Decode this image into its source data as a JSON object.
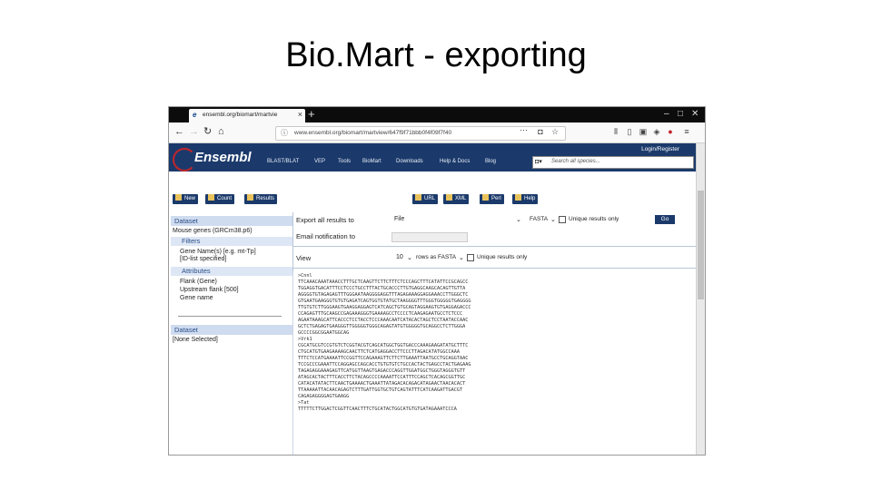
{
  "slide": {
    "title": "Bio.Mart - exporting"
  },
  "browser": {
    "tab_title": "ensembl.org/biomart/martvie",
    "url": "www.ensembl.org/biomart/martview/647f9f71bbb0f4f09f7f40",
    "window_controls": [
      "–",
      "□",
      "✕"
    ]
  },
  "ensembl": {
    "logo": "Ensembl",
    "nav": [
      "BLAST/BLAT",
      "VEP",
      "Tools",
      "BioMart",
      "Downloads",
      "Help & Docs",
      "Blog"
    ],
    "login": "Login/Register",
    "search_placeholder": "Search all species..."
  },
  "toolbar": {
    "new": "New",
    "count": "Count",
    "results": "Results",
    "url": "URL",
    "xml": "XML",
    "perl": "Perl",
    "help": "Help"
  },
  "left_panel": {
    "dataset_header": "Dataset",
    "dataset_value": "Mouse genes (GRCm38.p6)",
    "filters_header": "Filters",
    "filter_lines": [
      "Gene Name(s) [e.g. mt-Tp]",
      "[ID-list specified]"
    ],
    "attributes_header": "Attributes",
    "attribute_lines": [
      "Flank (Gene)",
      "Upstream flank [500]",
      "Gene name"
    ],
    "dataset2_header": "Dataset",
    "dataset2_value": "[None Selected]"
  },
  "export": {
    "label": "Export  all results to",
    "target": "File",
    "format": "FASTA",
    "unique_label": "Unique results only",
    "go": "Go",
    "email_label": "Email notification to"
  },
  "view": {
    "label": "View",
    "rows": "10",
    "rows_as": "rows as",
    "format": "FASTA",
    "unique_label": "Unique results only"
  },
  "sequences": [
    ">Cnnl",
    "TTCAAACAAATAAACCTTTGCTCAAGTTCTTCTTTCTCCCAGCTTTCATATTCCGCAGCC",
    "TGGAGGTGACATTTCCTCCCTGCCTTTACTGCACCCTTGTGAGGCAAGCACAGTTGTTA",
    "AGGGGTGTAGAGAGTTTGGGAATAAGGGGAGGTTTAGAGAAAGGAGGAAACCTTGGGCTC",
    "GTGAATGAAGGGTGTGTGAGATCAGTGGTGTATGCTAAGGGGTTTGGGTGGGGGTGAGGGG",
    "TTGTGTCTTGGGAAGTGAAGGAGGAGTCATCAGCTGTGCAGTAGGAAGTGTGAGGAGACCC",
    "CCAGAGTTTGCAAGCCGAGAAAGGGTGAAAAGCCTCCCCTCAAGAGAATGCCTCTCCC",
    "AGAATAAAGCATTCACCCTCCTACCTCCCAAACAATCATACACTAGCTCCTAATACCAAC",
    "GCTCTGAGAGTGAAGGGTTGGGGGTGGGCAGAGTATGTGGGGGTGCAGGCCTCTTGGGA",
    "GCCCCGGCGGAATGGCAG",
    ">Vrk1",
    "CGCATGCGTCCGTGTCTCGGTACGTCAGCATGGCTGGTGACCCAAAGAAGATATGCTTTC",
    "CTGCATGTGAAGAAAAGCAACTTCTCATGAGGACCTTCCCTTAGACATATGGCCAAA",
    "TTTCTCCATGAAAATTCCGGTTCCAGAAAGTTCTTCTTGAAATTAATGCCTGCAGGTAAC",
    "TCCGCCCGAAATTCCAGGAGCCAGCACCTGTGTGTCTGCCACTACTGAGCCTACTGAGAAG",
    "TAGAGAGGAAAGAGTTCATGGTTAAGTGAGACCCAGGTTGGATGGCTGGGTAGGGTGTT",
    "ATAGCACTACTTTCACCTTCTACAGCCCCAAAATTCCATTTCCAGCTCACAGCGGTTGC",
    "CATACATATACTTCAACTGAAAACTGAAATTATAGACACAGACATAGAACTAACACACT",
    "TTAAAAATTACAACAGAGTCTTTGATTGGTGCTGTCAGTATTTCATCAAGATTGACGT",
    "CAGAGAGGGGAGTGAAGG",
    ">Tat",
    "TTTTTCTTGGACTCGGTTCAACTTTCTGCATACTGGCATGTGTGATAGAAATCCCA"
  ]
}
